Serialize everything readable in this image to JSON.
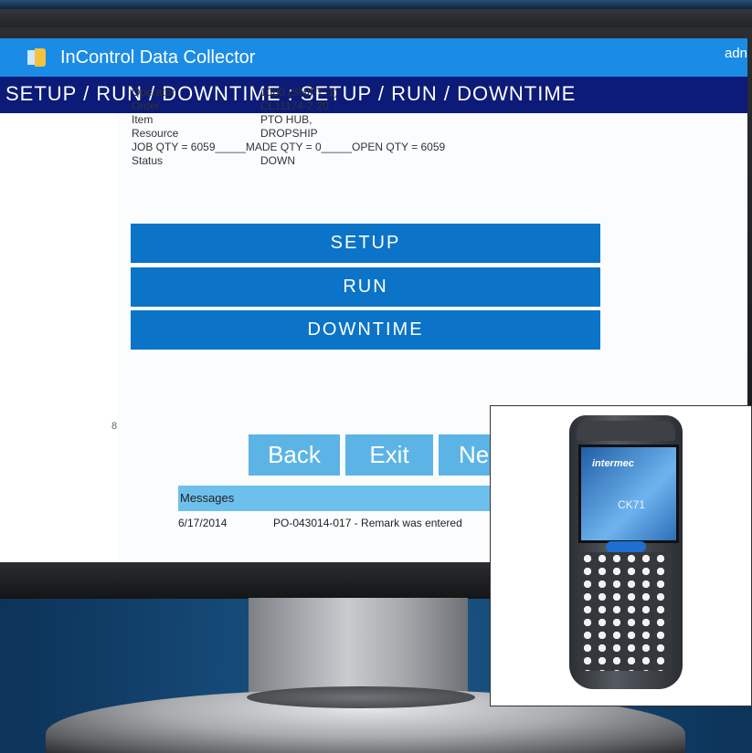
{
  "window": {
    "app_title": "InControl Data Collector",
    "user": "adn"
  },
  "page_heading": "SETUP / RUN / DOWNTIME : SETUP / RUN / DOWNTIME",
  "info": {
    "operator_label": "Operator",
    "operator_value": "1000 (SHIFT: 1)",
    "order_label": "Order",
    "order_value": "CL11174-2-20",
    "item_label": "Item",
    "item_value": "PTO HUB,",
    "resource_label": "Resource",
    "resource_value": "DROPSHIP",
    "qty_line": "JOB QTY = 6059_____MADE QTY = 0_____OPEN QTY = 6059",
    "status_label": "Status",
    "status_value": "DOWN"
  },
  "actions": {
    "setup": "SETUP",
    "run": "RUN",
    "downtime": "DOWNTIME"
  },
  "nav": {
    "back": "Back",
    "exit": "Exit",
    "next": "Ne"
  },
  "grip": "8",
  "messages": {
    "header": "Messages",
    "rows": [
      {
        "date": "6/17/2014",
        "text": "PO-043014-017 - Remark was entered"
      }
    ]
  },
  "device": {
    "brand": "intermec",
    "model": "CK71"
  },
  "colors": {
    "titlebar": "#1a8ce6",
    "subhead": "#0c1a78",
    "action_button": "#0b74c8",
    "nav_button": "#5cb4e6",
    "messages_header": "#6ec0ec"
  }
}
